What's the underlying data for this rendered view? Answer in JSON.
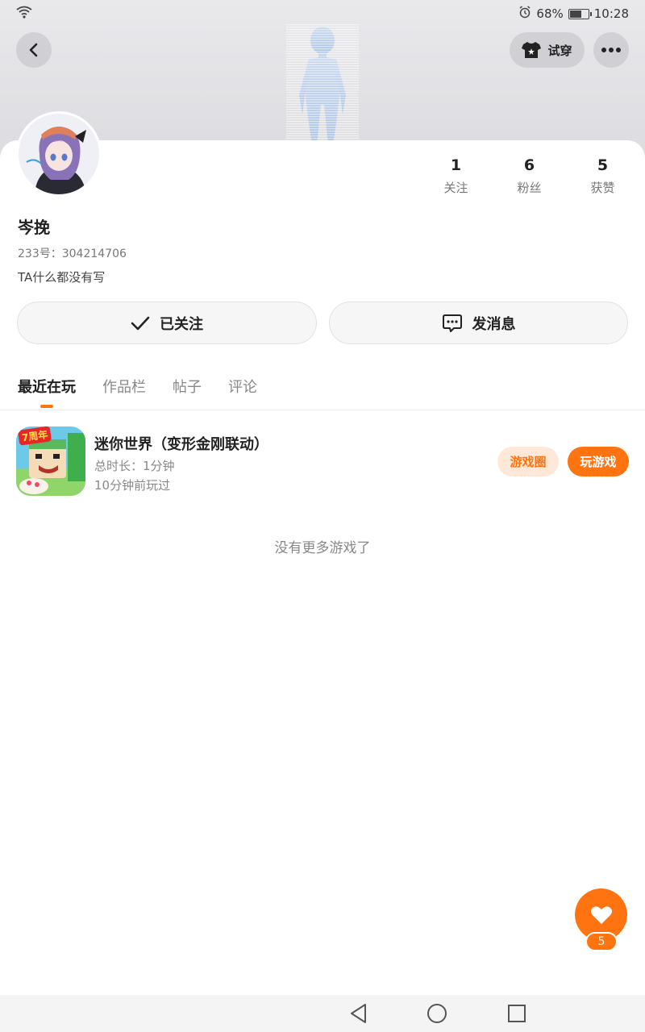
{
  "status_bar": {
    "battery": "68%",
    "time": "10:28",
    "battery_level": 0.68
  },
  "header": {
    "tryon_label": "试穿"
  },
  "profile": {
    "name": "岑挽",
    "uid": "233号：304214706",
    "bio": "TA什么都没有写"
  },
  "stats": [
    {
      "value": "1",
      "label": "关注"
    },
    {
      "value": "6",
      "label": "粉丝"
    },
    {
      "value": "5",
      "label": "获赞"
    }
  ],
  "actions": {
    "follow_label": "已关注",
    "message_label": "发消息"
  },
  "tabs": [
    {
      "label": "最近在玩",
      "active": true
    },
    {
      "label": "作品栏",
      "active": false
    },
    {
      "label": "帖子",
      "active": false
    },
    {
      "label": "评论",
      "active": false
    }
  ],
  "game": {
    "title": "迷你世界（变形金刚联动）",
    "duration": "总时长：1分钟",
    "last_played": "10分钟前玩过",
    "icon_badge": "7周年",
    "circle_label": "游戏圈",
    "play_label": "玩游戏"
  },
  "no_more": "没有更多游戏了",
  "likes_badge": "5",
  "colors": {
    "accent": "#ff7310",
    "accent_light": "#ffe8d8"
  }
}
